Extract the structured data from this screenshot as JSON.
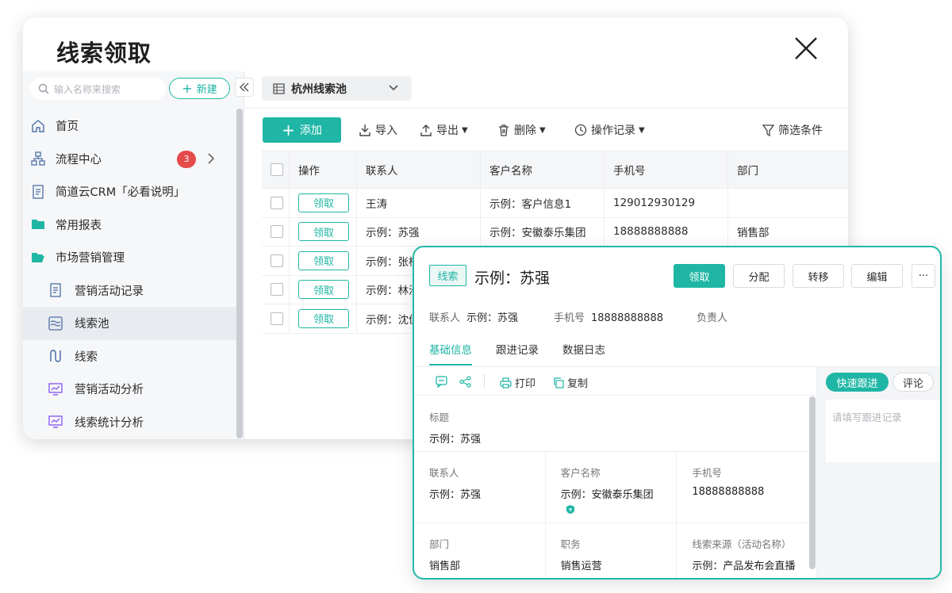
{
  "window": {
    "title": "线索领取"
  },
  "sidebar": {
    "search_placeholder": "输入名称来搜索",
    "new_label": "新建",
    "items": [
      {
        "label": "首页",
        "icon": "home-icon"
      },
      {
        "label": "流程中心",
        "icon": "flow-icon",
        "badge": "3"
      },
      {
        "label": "简道云CRM「必看说明」",
        "icon": "document-icon"
      },
      {
        "label": "常用报表",
        "icon": "folder-icon"
      },
      {
        "label": "市场营销管理",
        "icon": "folder-open-icon"
      },
      {
        "label": "营销活动记录",
        "icon": "form-icon"
      },
      {
        "label": "线索池",
        "icon": "pool-icon"
      },
      {
        "label": "线索",
        "icon": "lead-icon"
      },
      {
        "label": "营销活动分析",
        "icon": "dashboard-icon"
      },
      {
        "label": "线索统计分析",
        "icon": "dashboard-icon"
      }
    ]
  },
  "main": {
    "pool_name": "杭州线索池",
    "toolbar": {
      "add": "添加",
      "import": "导入",
      "export": "导出",
      "delete": "删除",
      "history": "操作记录",
      "filter": "筛选条件"
    },
    "table": {
      "headers": [
        "操作",
        "联系人",
        "客户名称",
        "手机号",
        "部门"
      ],
      "action_label": "领取",
      "rows": [
        {
          "contact": "王涛",
          "customer": "示例：客户信息1",
          "phone": "129012930129",
          "dept": ""
        },
        {
          "contact": "示例：苏强",
          "customer": "示例：安徽泰乐集团",
          "phone": "18888888888",
          "dept": "销售部"
        },
        {
          "contact": "示例：张梓",
          "customer": "",
          "phone": "",
          "dept": ""
        },
        {
          "contact": "示例：林汐",
          "customer": "",
          "phone": "",
          "dept": ""
        },
        {
          "contact": "示例：沈佳",
          "customer": "",
          "phone": "",
          "dept": ""
        }
      ]
    }
  },
  "detail": {
    "tag": "线索",
    "title": "示例：苏强",
    "buttons": {
      "claim": "领取",
      "assign": "分配",
      "transfer": "转移",
      "edit": "编辑",
      "more": "···"
    },
    "meta": {
      "contact_label": "联系人",
      "contact_value": "示例：苏强",
      "phone_label": "手机号",
      "phone_value": "18888888888",
      "owner_label": "负责人"
    },
    "tabs": [
      "基础信息",
      "跟进记录",
      "数据日志"
    ],
    "actions": {
      "print": "打印",
      "copy": "复制"
    },
    "fields": {
      "title_label": "标题",
      "title_value": "示例：苏强",
      "contact_label": "联系人",
      "contact_value": "示例：苏强",
      "customer_label": "客户名称",
      "customer_value": "示例：安徽泰乐集团",
      "phone_label": "手机号",
      "phone_value": "18888888888",
      "dept_label": "部门",
      "dept_value": "销售部",
      "position_label": "职务",
      "position_value": "销售运营",
      "source_label": "线索来源（活动名称）",
      "source_value": "示例：产品发布会直播"
    },
    "follow": {
      "quick_label": "快速跟进",
      "comment_label": "评论",
      "placeholder": "请填写跟进记录"
    }
  },
  "colors": {
    "accent": "#1fb6a5",
    "badge": "#e54b4b"
  }
}
